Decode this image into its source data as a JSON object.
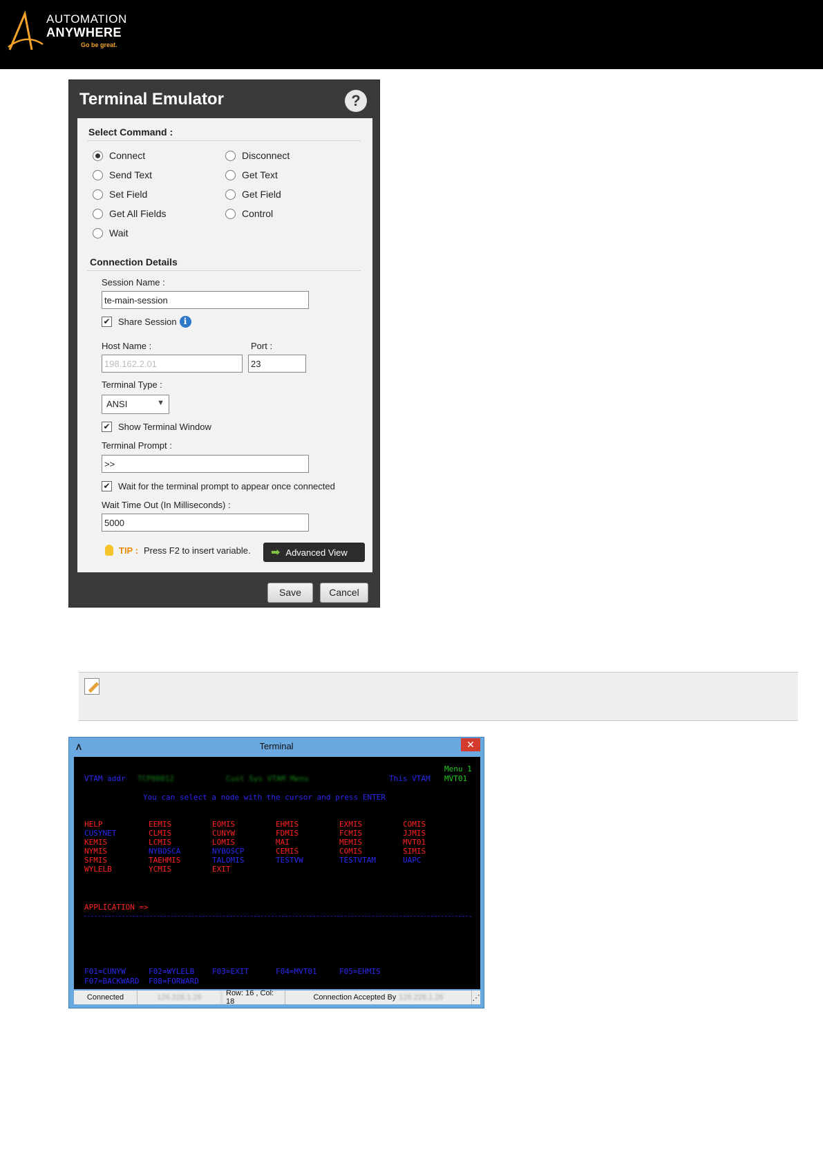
{
  "header": {
    "logo_line1": "AUTOMATION",
    "logo_line2": "ANYWHERE",
    "logo_tagline": "Go be great.",
    "colors": {
      "bg": "#000000",
      "accent": "#f3a32a"
    }
  },
  "dialog": {
    "title": "Terminal Emulator",
    "help_icon": "?",
    "select_command_label": "Select Command :",
    "commands": [
      {
        "label": "Connect",
        "selected": true
      },
      {
        "label": "Disconnect",
        "selected": false
      },
      {
        "label": "Send Text",
        "selected": false
      },
      {
        "label": "Get Text",
        "selected": false
      },
      {
        "label": "Set Field",
        "selected": false
      },
      {
        "label": "Get Field",
        "selected": false
      },
      {
        "label": "Get All Fields",
        "selected": false
      },
      {
        "label": "Control",
        "selected": false
      },
      {
        "label": "Wait",
        "selected": false
      }
    ],
    "connection_details_label": "Connection Details",
    "session_name_label": "Session Name :",
    "session_name_value": "te-main-session",
    "share_session_label": "Share Session",
    "share_session_checked": "✔",
    "info_icon": "i",
    "host_name_label": "Host Name :",
    "host_name_value": "198.162.2.01",
    "port_label": "Port :",
    "port_value": "23",
    "terminal_type_label": "Terminal Type :",
    "terminal_type_value": "ANSI",
    "show_terminal_window_label": "Show Terminal Window",
    "show_terminal_window_checked": "✔",
    "terminal_prompt_label": "Terminal Prompt :",
    "terminal_prompt_value": ">>",
    "wait_prompt_label": "Wait for the terminal prompt to appear once connected",
    "wait_prompt_checked": "✔",
    "wait_timeout_label": "Wait Time Out (In Milliseconds) :",
    "wait_timeout_value": "5000",
    "tip_key": "TIP :",
    "tip_text": "Press F2 to insert variable.",
    "advanced_view_label": "Advanced View",
    "save_label": "Save",
    "cancel_label": "Cancel"
  },
  "terminal": {
    "title": "Terminal",
    "close_label": "✕",
    "menu_label": "Menu 1",
    "vtam_label": "VTAM addr",
    "vtam_value": "TCP00012",
    "system_name": "Cust Sys VTAM Menu",
    "this_vtam_label": "This VTAM",
    "this_vtam_value": "MVT01",
    "instruction": "You can select a node with the cursor and press ENTER",
    "grid": [
      [
        [
          "HELP",
          "r"
        ],
        [
          "EEMIS",
          "r"
        ],
        [
          "EOMIS",
          "r"
        ],
        [
          "EHMIS",
          "r"
        ],
        [
          "EXMIS",
          "r"
        ],
        [
          "COMIS",
          "r"
        ]
      ],
      [
        [
          "CUSYNET",
          "b"
        ],
        [
          "CLMIS",
          "r"
        ],
        [
          "CUNYW",
          "r"
        ],
        [
          "FDMIS",
          "r"
        ],
        [
          "FCMIS",
          "r"
        ],
        [
          "JJMIS",
          "r"
        ]
      ],
      [
        [
          "KEMIS",
          "r"
        ],
        [
          "LCMIS",
          "r"
        ],
        [
          "LOMIS",
          "r"
        ],
        [
          "MAI",
          "r"
        ],
        [
          "MEMIS",
          "r"
        ],
        [
          "MVT01",
          "r"
        ]
      ],
      [
        [
          "NYMIS",
          "r"
        ],
        [
          "NYBOSCA",
          "b"
        ],
        [
          "NYBOSCP",
          "b"
        ],
        [
          "CEMIS",
          "r"
        ],
        [
          "COMIS",
          "r"
        ],
        [
          "SIMIS",
          "r"
        ]
      ],
      [
        [
          "SFMIS",
          "r"
        ],
        [
          "TAEHMIS",
          "r"
        ],
        [
          "TALOMIS",
          "b"
        ],
        [
          "TESTVW",
          "b"
        ],
        [
          "TESTVTAM",
          "b"
        ],
        [
          "UAPC",
          "b"
        ]
      ],
      [
        [
          "WYLELB",
          "r"
        ],
        [
          "YCMIS",
          "r"
        ],
        [
          "EXIT",
          "r"
        ]
      ]
    ],
    "application_prompt": "APPLICATION =>",
    "fkeys_line1": [
      "F01=CUNYW",
      "F02=WYLELB",
      "F03=EXIT",
      "F04=MVT01",
      "F05=EHMIS"
    ],
    "fkeys_line2": [
      "F07=BACKWARD",
      "F08=FORWARD"
    ],
    "status": {
      "connected": "Connected",
      "host": "126.226.1.26",
      "position": "Row: 16 , Col: 18",
      "accepted_label": "Connection Accepted By",
      "accepted_host": "126.226.1.26"
    },
    "colors": {
      "blue": "#2a2af0",
      "red": "#ff2222",
      "green": "#22cc22",
      "frame": "#6aa8e0"
    }
  }
}
